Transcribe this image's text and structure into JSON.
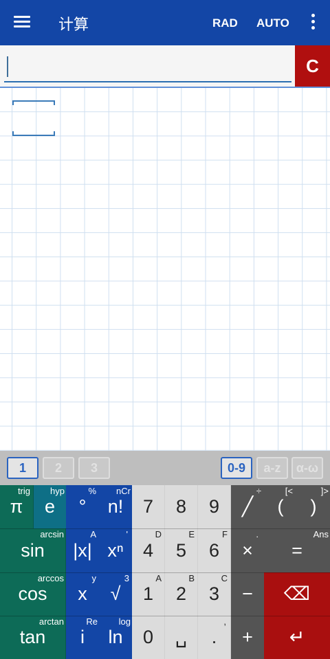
{
  "app": {
    "title": "计算",
    "mode_angle": "RAD",
    "mode_output": "AUTO",
    "clear_label": "C"
  },
  "tabs": [
    "1",
    "2",
    "3",
    "0-9",
    "a-z",
    "α-ω"
  ],
  "keys": {
    "pi": {
      "label": "π",
      "sup": "trig"
    },
    "e": {
      "label": "e",
      "sup": "hyp"
    },
    "deg": {
      "label": "°",
      "sup": "%"
    },
    "fact": {
      "label": "n!",
      "sup": "nCr"
    },
    "seven": {
      "label": "7"
    },
    "eight": {
      "label": "8"
    },
    "nine": {
      "label": "9"
    },
    "divide": {
      "label": "╱",
      "sup": "÷"
    },
    "lparen": {
      "label": "(",
      "sup": "[<"
    },
    "rparen": {
      "label": ")",
      "sup": "]>"
    },
    "sin": {
      "label": "sin",
      "sup": "arcsin"
    },
    "abs": {
      "label": "|x|",
      "sup": "A"
    },
    "pow": {
      "label": "xⁿ",
      "sup": "'"
    },
    "four": {
      "label": "4",
      "sup": "D"
    },
    "five": {
      "label": "5",
      "sup": "E"
    },
    "six": {
      "label": "6",
      "sup": "F"
    },
    "times": {
      "label": "×",
      "sup": "."
    },
    "equals": {
      "label": "=",
      "sup": "Ans"
    },
    "cos": {
      "label": "cos",
      "sup": "arccos"
    },
    "x": {
      "label": "x",
      "sup": "y"
    },
    "sqrt": {
      "label": "√",
      "sup": "3"
    },
    "one": {
      "label": "1",
      "sup": "A"
    },
    "two": {
      "label": "2",
      "sup": "B"
    },
    "three": {
      "label": "3",
      "sup": "C"
    },
    "minus": {
      "label": "−"
    },
    "backspace": {
      "label": "⌫"
    },
    "tan": {
      "label": "tan",
      "sup": "arctan"
    },
    "i": {
      "label": "i",
      "sup": "Re"
    },
    "ln": {
      "label": "ln",
      "sup": "log"
    },
    "zero": {
      "label": "0"
    },
    "space": {
      "label": "␣"
    },
    "dot": {
      "label": ".",
      "sup": ","
    },
    "plus": {
      "label": "+"
    },
    "enter": {
      "label": "↵"
    }
  },
  "colors": {
    "appbar": "#1346a6",
    "clear_button": "#b00f0f",
    "trig_keys": "#0d6b57",
    "function_keys": "#1346a6",
    "digit_keys": "#dcdcdc",
    "operator_keys": "#545454",
    "backspace_enter": "#a90f0f"
  }
}
